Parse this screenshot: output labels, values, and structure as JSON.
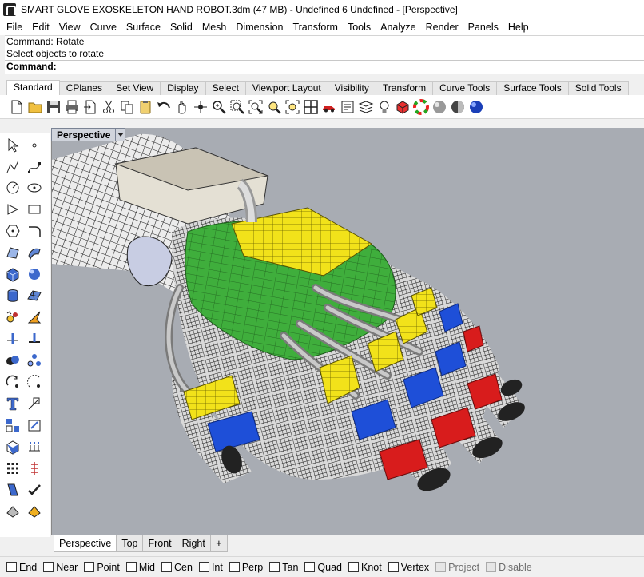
{
  "window": {
    "title": "SMART GLOVE EXOSKELETON HAND ROBOT.3dm (47 MB) - Undefined 6 Undefined - [Perspective]"
  },
  "menu": [
    "File",
    "Edit",
    "View",
    "Curve",
    "Surface",
    "Solid",
    "Mesh",
    "Dimension",
    "Transform",
    "Tools",
    "Analyze",
    "Render",
    "Panels",
    "Help"
  ],
  "command": {
    "line1": "Command: Rotate",
    "line2": "Select objects to rotate",
    "prompt": "Command:"
  },
  "toolbar_tabs": [
    "Standard",
    "CPlanes",
    "Set View",
    "Display",
    "Select",
    "Viewport Layout",
    "Visibility",
    "Transform",
    "Curve Tools",
    "Surface Tools",
    "Solid Tools"
  ],
  "toolbar_icons": [
    "new-icon",
    "open-icon",
    "save-icon",
    "print-icon",
    "import-icon",
    "cut-icon",
    "copy-icon",
    "paste-icon",
    "undo-icon",
    "pan-icon",
    "rotate-view-icon",
    "zoom-icon",
    "zoom-window-icon",
    "zoom-extents-icon",
    "zoom-selected-icon",
    "zoom-all-icon",
    "viewport-grid-icon",
    "car-icon",
    "properties-icon",
    "layer-icon",
    "light-icon",
    "material-icon",
    "color-wheel-icon",
    "shaded-icon",
    "rendered-icon",
    "sphere-icon"
  ],
  "viewport": {
    "label": "Perspective",
    "tabs": [
      "Perspective",
      "Top",
      "Front",
      "Right"
    ],
    "add_tab": "+"
  },
  "osnaps": [
    {
      "label": "End",
      "checked": false,
      "enabled": true
    },
    {
      "label": "Near",
      "checked": false,
      "enabled": true
    },
    {
      "label": "Point",
      "checked": false,
      "enabled": true
    },
    {
      "label": "Mid",
      "checked": false,
      "enabled": true
    },
    {
      "label": "Cen",
      "checked": false,
      "enabled": true
    },
    {
      "label": "Int",
      "checked": false,
      "enabled": true
    },
    {
      "label": "Perp",
      "checked": false,
      "enabled": true
    },
    {
      "label": "Tan",
      "checked": false,
      "enabled": true
    },
    {
      "label": "Quad",
      "checked": false,
      "enabled": true
    },
    {
      "label": "Knot",
      "checked": false,
      "enabled": true
    },
    {
      "label": "Vertex",
      "checked": false,
      "enabled": true
    },
    {
      "label": "Project",
      "checked": false,
      "enabled": false
    },
    {
      "label": "Disable",
      "checked": false,
      "enabled": false
    }
  ],
  "colors": {
    "viewport_bg": "#a8acb3",
    "exo_yellow": "#f2e21a",
    "exo_green": "#3fae3c",
    "exo_blue": "#1e4fd8",
    "exo_red": "#d81c1c",
    "wire": "#1a1a1a"
  }
}
